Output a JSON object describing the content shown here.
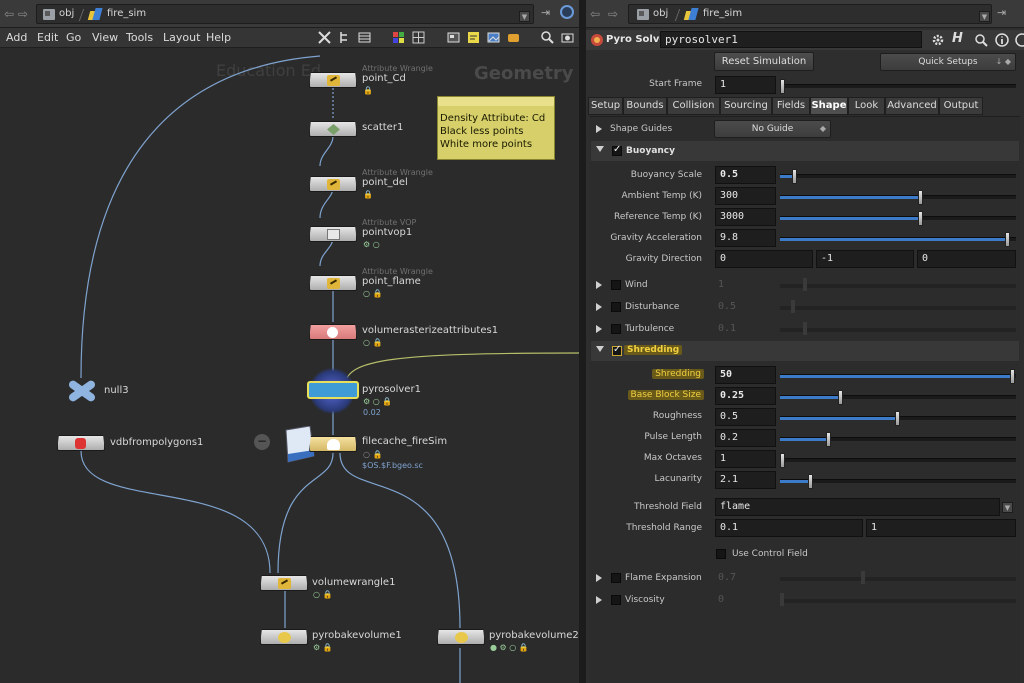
{
  "left": {
    "path": {
      "root": "obj",
      "node": "fire_sim"
    },
    "menu": [
      "Add",
      "Edit",
      "Go",
      "View",
      "Tools",
      "Layout",
      "Help"
    ],
    "watermark_left": "Education Ed",
    "watermark_right": "Geometry",
    "sticky": [
      "Density Attribute: Cd",
      "Black less points",
      "White more points"
    ],
    "nodes": {
      "point_cd": {
        "type": "Attribute Wrangle",
        "name": "point_Cd"
      },
      "scatter": {
        "name": "scatter1"
      },
      "point_del": {
        "type": "Attribute Wrangle",
        "name": "point_del"
      },
      "pointvop": {
        "type": "Attribute VOP",
        "name": "pointvop1"
      },
      "point_flame": {
        "type": "Attribute Wrangle",
        "name": "point_flame"
      },
      "raster": {
        "name": "volumerasterizeattributes1"
      },
      "null": {
        "name": "null3"
      },
      "vdb": {
        "name": "vdbfrompolygons1"
      },
      "pyro": {
        "name": "pyrosolver1",
        "time": "0.02"
      },
      "cache": {
        "name": "filecache_fireSim",
        "path": "$OS.$F.bgeo.sc"
      },
      "vwrangle": {
        "name": "volumewrangle1"
      },
      "bake1": {
        "name": "pyrobakevolume1"
      },
      "bake2": {
        "name": "pyrobakevolume2"
      }
    },
    "link_color": "#7fa3cf"
  },
  "right": {
    "path": {
      "root": "obj",
      "node": "fire_sim"
    },
    "node_type": "Pyro Solver",
    "node_name": "pyrosolver1",
    "reset_btn": "Reset Simulation",
    "quick_setups": "Quick Setups",
    "start_frame": {
      "label": "Start Frame",
      "value": "1"
    },
    "tabs": [
      "Setup",
      "Bounds",
      "Collision",
      "Sourcing",
      "Fields",
      "Shape",
      "Look",
      "Advanced",
      "Output"
    ],
    "active_tab": "Shape",
    "shape_guides": {
      "label": "Shape Guides",
      "value": "No Guide"
    },
    "buoyancy": {
      "title": "Buoyancy",
      "scale": {
        "label": "Buoyancy Scale",
        "value": "0.5",
        "frac": 0.05
      },
      "ambient": {
        "label": "Ambient Temp (K)",
        "value": "300",
        "frac": 0.6
      },
      "reference": {
        "label": "Reference Temp (K)",
        "value": "3000",
        "frac": 0.6
      },
      "gravity": {
        "label": "Gravity Acceleration",
        "value": "9.8",
        "frac": 0.98
      },
      "direction": {
        "label": "Gravity Direction",
        "x": "0",
        "y": "-1",
        "z": "0"
      }
    },
    "wind": {
      "title": "Wind",
      "value": "1"
    },
    "disturbance": {
      "title": "Disturbance",
      "value": "0.5"
    },
    "turbulence": {
      "title": "Turbulence",
      "value": "0.1"
    },
    "shredding": {
      "title": "Shredding",
      "amount": {
        "label": "Shredding",
        "value": "50",
        "frac": 1.0
      },
      "block": {
        "label": "Base Block Size",
        "value": "0.25",
        "frac": 0.25
      },
      "rough": {
        "label": "Roughness",
        "value": "0.5",
        "frac": 0.5
      },
      "pulse": {
        "label": "Pulse Length",
        "value": "0.2",
        "frac": 0.2
      },
      "octaves": {
        "label": "Max Octaves",
        "value": "1",
        "frac": 0.0
      },
      "lacunarity": {
        "label": "Lacunarity",
        "value": "2.1",
        "frac": 0.12
      },
      "threshold_field": {
        "label": "Threshold Field",
        "value": "flame"
      },
      "threshold_range": {
        "label": "Threshold Range",
        "min": "0.1",
        "max": "1"
      },
      "use_control": "Use Control Field"
    },
    "flame_expansion": {
      "title": "Flame Expansion",
      "value": "0.7"
    },
    "viscosity": {
      "title": "Viscosity",
      "value": "0"
    },
    "accent": "#3c7bc8",
    "highlight": "#f0d040"
  }
}
